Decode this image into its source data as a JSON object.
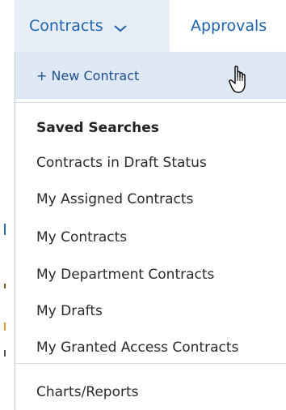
{
  "nav": {
    "contracts_label": "Contracts",
    "approvals_label": "Approvals"
  },
  "dropdown": {
    "new_contract": "+ New Contract",
    "saved_searches_heading": "Saved Searches",
    "items": [
      "Contracts in Draft Status",
      "My Assigned Contracts",
      "My Contracts",
      "My Department Contracts",
      "My Drafts",
      "My Granted Access Contracts"
    ],
    "charts_reports": "Charts/Reports"
  },
  "colors": {
    "accent": "#1f63b0",
    "nav_active_bg": "#e8eef7",
    "hover_bg": "#dfe8f5"
  }
}
